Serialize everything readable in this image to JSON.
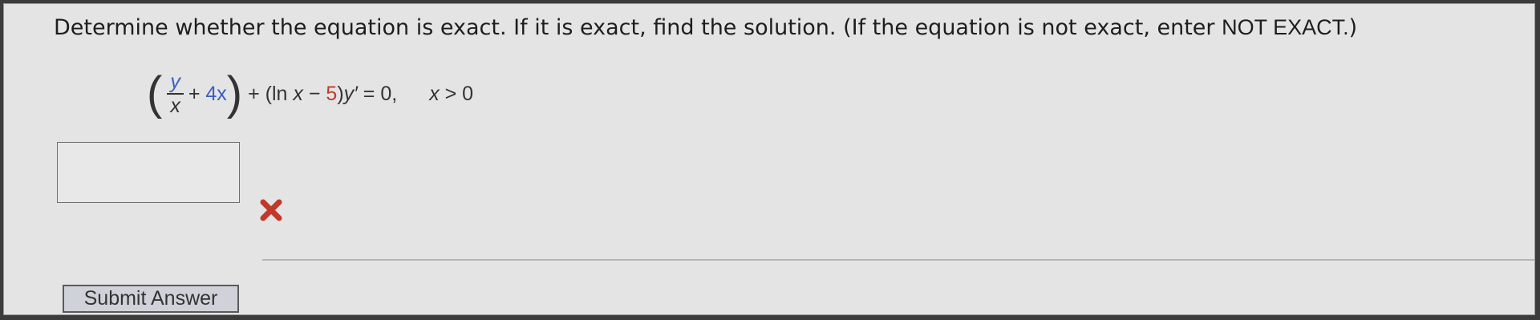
{
  "question": {
    "prompt_prefix": "Determine whether the equation is exact. If it is exact, find the solution. (If the equation is not exact, enter ",
    "not_exact_keyword": "NOT EXACT.",
    "prompt_suffix": ")"
  },
  "equation": {
    "open_paren": "(",
    "frac_num": "y",
    "frac_den": "x",
    "plus1": "+",
    "term": "4x",
    "close_paren": ")",
    "plus2": "+",
    "ln_open": "(ln",
    "ln_var": "x",
    "minus": "−",
    "five": "5",
    "ln_close": ")",
    "y_prime": "y′",
    "equals_zero": "= 0,",
    "cond_var": "x",
    "cond_rest": "> 0"
  },
  "answer": {
    "value": ""
  },
  "feedback": {
    "icon": "x-mark-icon",
    "color": "#c0392b"
  },
  "submit": {
    "label": "Submit Answer"
  }
}
